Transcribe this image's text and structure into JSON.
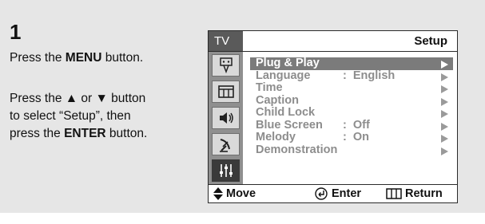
{
  "step": {
    "number": "1"
  },
  "instructions": {
    "line1": {
      "pre": "Press the ",
      "bold": "MENU",
      "post": " button."
    },
    "line2": {
      "a": "Press the ",
      "up_symbol": "▲",
      "b": " or ",
      "down_symbol": "▼",
      "c": " button",
      "d": "to select “Setup”, then",
      "e": "press the ",
      "bold": "ENTER",
      "f": " button."
    }
  },
  "osd": {
    "tab": "TV",
    "title": "Setup",
    "icons": [
      "antenna-input-icon",
      "channel-list-icon",
      "speaker-sound-icon",
      "satellite-dish-icon",
      "setup-sliders-icon"
    ],
    "items": [
      {
        "label": "Plug & Play",
        "value": "",
        "selected": true
      },
      {
        "label": "Language",
        "value": ":  English",
        "selected": false
      },
      {
        "label": "Time",
        "value": "",
        "selected": false
      },
      {
        "label": "Caption",
        "value": "",
        "selected": false
      },
      {
        "label": "Child Lock",
        "value": "",
        "selected": false
      },
      {
        "label": "Blue Screen",
        "value": ":  Off",
        "selected": false
      },
      {
        "label": "Melody",
        "value": ":  On",
        "selected": false
      },
      {
        "label": "Demonstration",
        "value": "",
        "selected": false
      }
    ],
    "footer": {
      "move": "Move",
      "enter": "Enter",
      "return": "Return"
    }
  },
  "colors": {
    "panel_bg": "#e6e6e6",
    "highlight": "#7b7b7b",
    "icon_column": "#8f8f8f"
  }
}
